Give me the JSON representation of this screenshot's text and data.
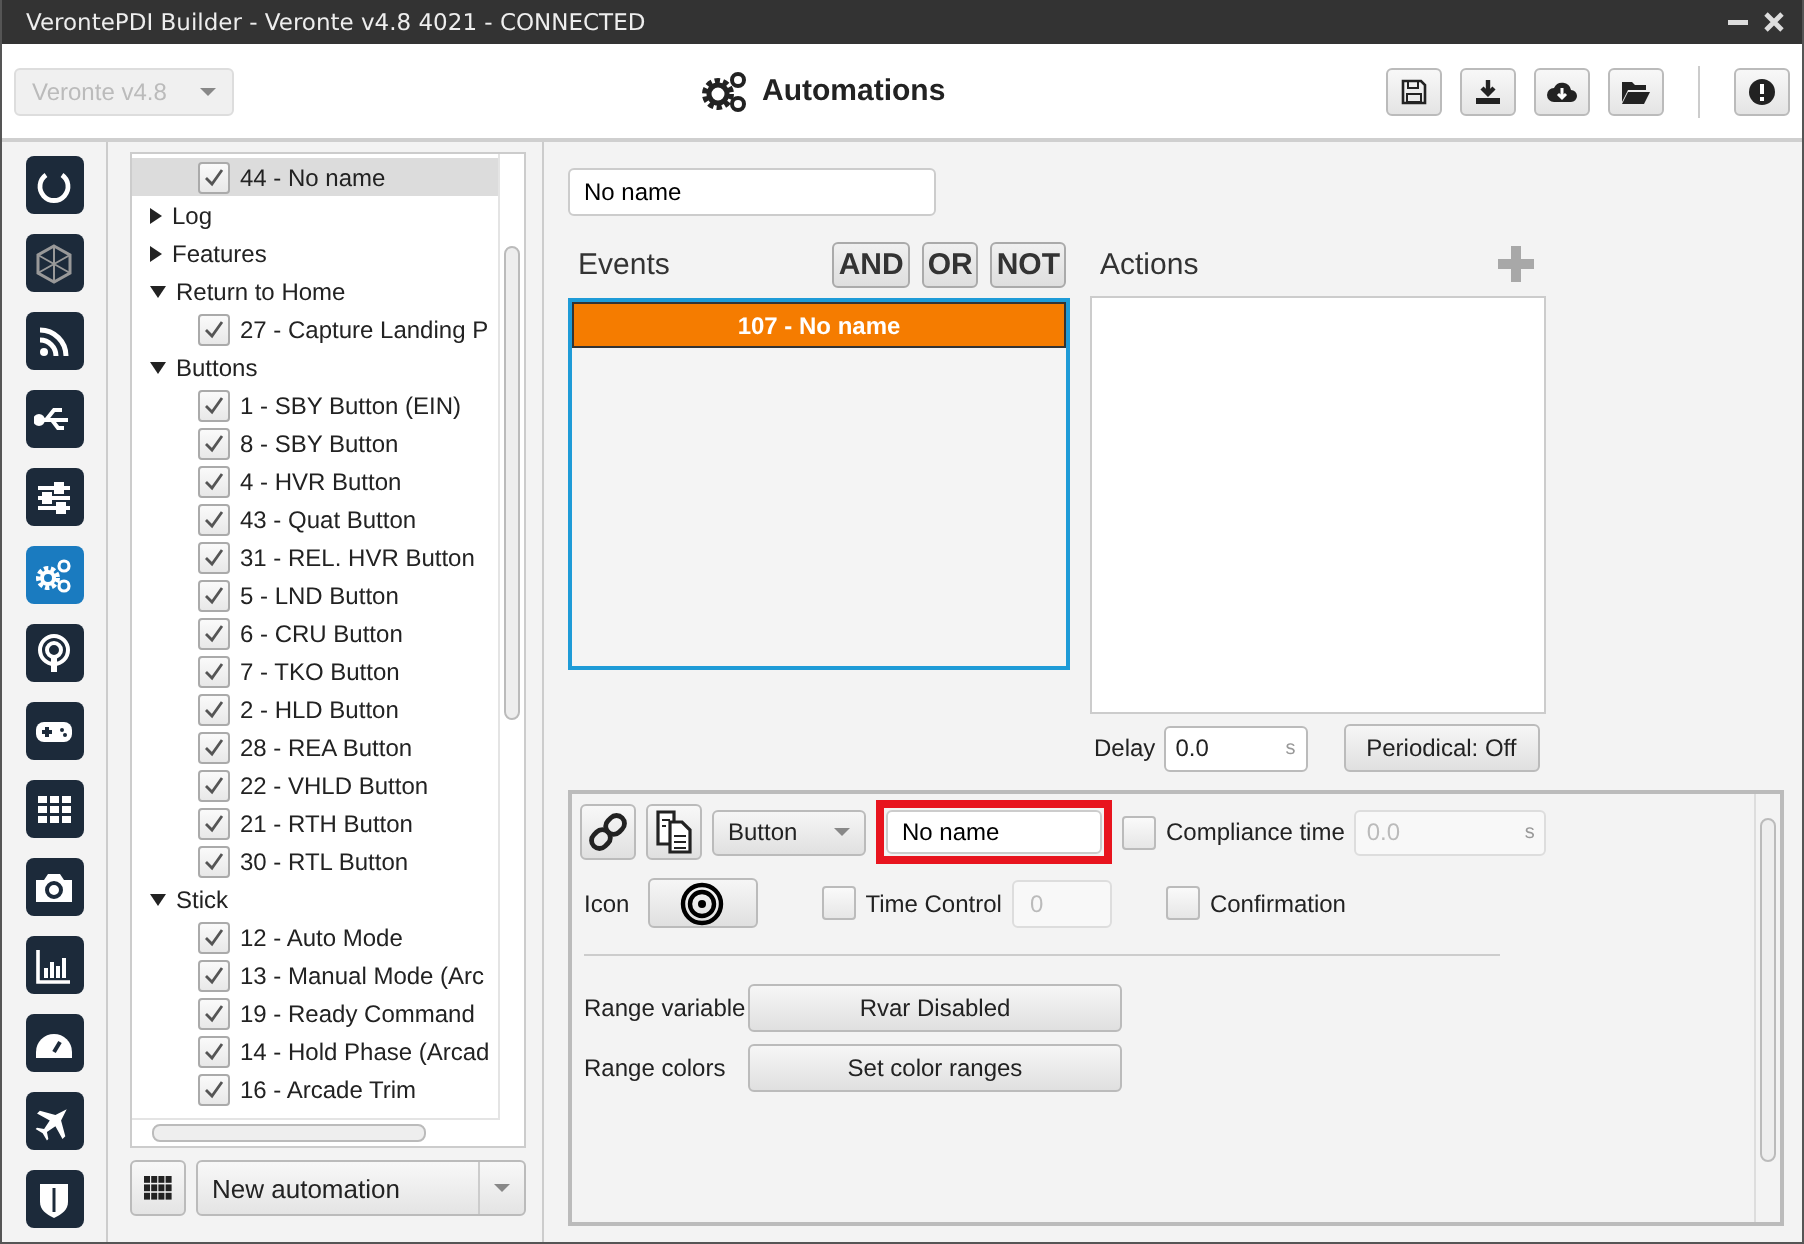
{
  "window": {
    "title": "VerontePDI Builder - Veronte v4.8 4021 - CONNECTED"
  },
  "toolbar": {
    "version_select": {
      "value": "Veronte v4.8",
      "disabled": true
    },
    "title": "Automations"
  },
  "rail": [
    {
      "selected": false
    },
    {
      "selected": false
    },
    {
      "selected": false
    },
    {
      "selected": false
    },
    {
      "selected": false
    },
    {
      "selected": true
    },
    {
      "selected": false
    },
    {
      "selected": false
    },
    {
      "selected": false
    },
    {
      "selected": false
    },
    {
      "selected": false
    },
    {
      "selected": false
    },
    {
      "selected": false
    },
    {
      "selected": false
    }
  ],
  "tree": [
    {
      "kind": "leaf",
      "label": "44 - No name",
      "checked": true,
      "selected": true
    },
    {
      "kind": "group",
      "label": "Log",
      "expanded": false
    },
    {
      "kind": "group",
      "label": "Features",
      "expanded": false
    },
    {
      "kind": "group",
      "label": "Return to Home",
      "expanded": true,
      "children": [
        {
          "kind": "leaf",
          "label": "27 - Capture Landing P",
          "checked": true,
          "selected": false
        }
      ]
    },
    {
      "kind": "group",
      "label": "Buttons",
      "expanded": true,
      "children": [
        {
          "kind": "leaf",
          "label": "1 - SBY Button (EIN)",
          "checked": true,
          "selected": false
        },
        {
          "kind": "leaf",
          "label": "8 - SBY Button",
          "checked": true,
          "selected": false
        },
        {
          "kind": "leaf",
          "label": "4 - HVR Button",
          "checked": true,
          "selected": false
        },
        {
          "kind": "leaf",
          "label": "43 - Quat Button",
          "checked": true,
          "selected": false
        },
        {
          "kind": "leaf",
          "label": "31 - REL. HVR Button",
          "checked": true,
          "selected": false
        },
        {
          "kind": "leaf",
          "label": "5 - LND Button",
          "checked": true,
          "selected": false
        },
        {
          "kind": "leaf",
          "label": "6 - CRU Button",
          "checked": true,
          "selected": false
        },
        {
          "kind": "leaf",
          "label": "7 - TKO Button",
          "checked": true,
          "selected": false
        },
        {
          "kind": "leaf",
          "label": "2 - HLD Button",
          "checked": true,
          "selected": false
        },
        {
          "kind": "leaf",
          "label": "28 - REA Button",
          "checked": true,
          "selected": false
        },
        {
          "kind": "leaf",
          "label": "22 - VHLD Button",
          "checked": true,
          "selected": false
        },
        {
          "kind": "leaf",
          "label": "21 - RTH Button",
          "checked": true,
          "selected": false
        },
        {
          "kind": "leaf",
          "label": "30 - RTL Button",
          "checked": true,
          "selected": false
        }
      ]
    },
    {
      "kind": "group",
      "label": "Stick",
      "expanded": true,
      "children": [
        {
          "kind": "leaf",
          "label": "12 - Auto Mode",
          "checked": true,
          "selected": false
        },
        {
          "kind": "leaf",
          "label": "13 - Manual Mode (Arc",
          "checked": true,
          "selected": false
        },
        {
          "kind": "leaf",
          "label": "19 - Ready Command",
          "checked": true,
          "selected": false
        },
        {
          "kind": "leaf",
          "label": "14 - Hold Phase (Arcad",
          "checked": true,
          "selected": false
        },
        {
          "kind": "leaf",
          "label": "16 - Arcade Trim",
          "checked": true,
          "selected": false
        }
      ]
    }
  ],
  "tree_footer": {
    "new_select": "New automation"
  },
  "automation": {
    "name": "No name",
    "events_label": "Events",
    "operators": [
      "AND",
      "OR",
      "NOT"
    ],
    "events": [
      {
        "label": "107 - No name",
        "selected": true
      }
    ],
    "actions_label": "Actions",
    "delay": {
      "label": "Delay",
      "value": "0.0",
      "unit": "s"
    },
    "periodical": "Periodical: Off"
  },
  "detail": {
    "type_select": "Button",
    "name": {
      "value": "No name",
      "highlighted": true
    },
    "compliance": {
      "label": "Compliance time",
      "checked": false,
      "value": "0.0",
      "unit": "s",
      "disabled": true
    },
    "icon_label": "Icon",
    "time_control": {
      "label": "Time Control",
      "checked": false,
      "value": "0",
      "disabled": true
    },
    "confirmation": {
      "label": "Confirmation",
      "checked": false
    },
    "range_variable": {
      "label": "Range variable",
      "button": "Rvar Disabled"
    },
    "range_colors": {
      "label": "Range colors",
      "button": "Set color ranges"
    }
  }
}
